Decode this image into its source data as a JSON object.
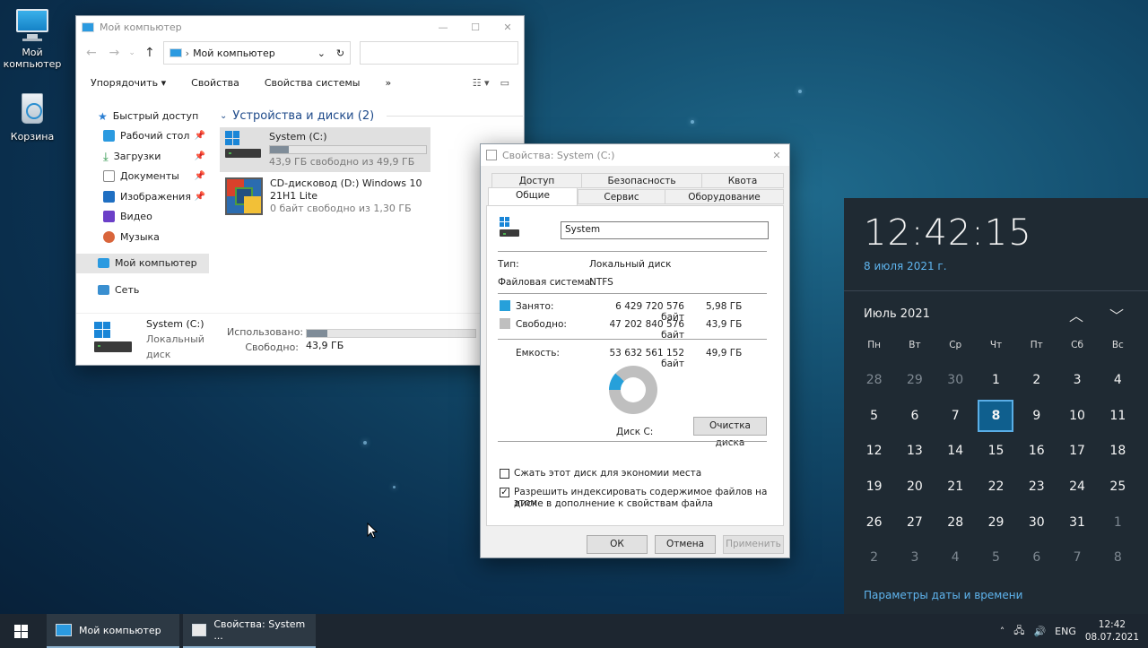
{
  "desktop": {
    "icons": [
      {
        "label": "Мой компьютер"
      },
      {
        "label": "Корзина"
      }
    ]
  },
  "explorer": {
    "title": "Мой компьютер",
    "address": "Мой компьютер",
    "ribbon": [
      "Упорядочить",
      "Свойства",
      "Свойства системы"
    ],
    "ribbon_more": "»",
    "nav": {
      "quick_access": "Быстрый доступ",
      "items": [
        "Рабочий стол",
        "Загрузки",
        "Документы",
        "Изображения",
        "Видео",
        "Музыка"
      ],
      "my_computer": "Мой компьютер",
      "network": "Сеть"
    },
    "group_title": "Устройства и диски (2)",
    "drives": [
      {
        "name": "System  (C:)",
        "free": "43,9 ГБ свободно из 49,9 ГБ",
        "used_fraction": 0.12
      },
      {
        "name": "CD-дисковод (D:) Windows 10",
        "name2": "21H1 Lite",
        "free": "0 байт свободно из 1,30 ГБ"
      }
    ],
    "details": {
      "name": "System  (C:)",
      "type": "Локальный диск",
      "used_label": "Использовано:",
      "free_label": "Свободно:",
      "free_value": "43,9 ГБ",
      "used_fraction": 0.12
    }
  },
  "props": {
    "title": "Свойства: System  (C:)",
    "tabs_row1": [
      "Доступ",
      "Безопасность",
      "Квота"
    ],
    "tabs_row2": [
      "Общие",
      "Сервис",
      "Оборудование"
    ],
    "name_value": "System",
    "type_label": "Тип:",
    "type_value": "Локальный диск",
    "fs_label": "Файловая система:",
    "fs_value": "NTFS",
    "used_label": "Занято:",
    "used_bytes": "6 429 720 576 байт",
    "used_gb": "5,98 ГБ",
    "free_label": "Свободно:",
    "free_bytes": "47 202 840 576 байт",
    "free_gb": "43,9 ГБ",
    "cap_label": "Емкость:",
    "cap_bytes": "53 632 561 152 байт",
    "cap_gb": "49,9 ГБ",
    "disk_label": "Диск C:",
    "cleanup": "Очистка диска",
    "compress": "Сжать этот диск для экономии места",
    "index": "Разрешить индексировать содержимое файлов на этом",
    "index2": "диске в дополнение к свойствам файла",
    "ok": "ОК",
    "cancel": "Отмена",
    "apply": "Применить",
    "used_color": "#26a0da",
    "free_color": "#bfbfbf"
  },
  "calendar": {
    "time": "12:42:15",
    "date": "8 июля 2021 г.",
    "month": "Июль 2021",
    "weekdays": [
      "Пн",
      "Вт",
      "Ср",
      "Чт",
      "Пт",
      "Сб",
      "Вс"
    ],
    "days": [
      {
        "d": "28",
        "dim": true
      },
      {
        "d": "29",
        "dim": true
      },
      {
        "d": "30",
        "dim": true
      },
      {
        "d": "1"
      },
      {
        "d": "2"
      },
      {
        "d": "3"
      },
      {
        "d": "4"
      },
      {
        "d": "5"
      },
      {
        "d": "6"
      },
      {
        "d": "7"
      },
      {
        "d": "8",
        "today": true
      },
      {
        "d": "9"
      },
      {
        "d": "10"
      },
      {
        "d": "11"
      },
      {
        "d": "12"
      },
      {
        "d": "13"
      },
      {
        "d": "14"
      },
      {
        "d": "15"
      },
      {
        "d": "16"
      },
      {
        "d": "17"
      },
      {
        "d": "18"
      },
      {
        "d": "19"
      },
      {
        "d": "20"
      },
      {
        "d": "21"
      },
      {
        "d": "22"
      },
      {
        "d": "23"
      },
      {
        "d": "24"
      },
      {
        "d": "25"
      },
      {
        "d": "26"
      },
      {
        "d": "27"
      },
      {
        "d": "28"
      },
      {
        "d": "29"
      },
      {
        "d": "30"
      },
      {
        "d": "31"
      },
      {
        "d": "1",
        "dim": true
      },
      {
        "d": "2",
        "dim": true
      },
      {
        "d": "3",
        "dim": true
      },
      {
        "d": "4",
        "dim": true
      },
      {
        "d": "5",
        "dim": true
      },
      {
        "d": "6",
        "dim": true
      },
      {
        "d": "7",
        "dim": true
      },
      {
        "d": "8",
        "dim": true
      }
    ],
    "link": "Параметры даты и времени"
  },
  "taskbar": {
    "tasks": [
      "Мой компьютер",
      "Свойства: System ..."
    ],
    "lang": "ENG",
    "time": "12:42",
    "date": "08.07.2021"
  }
}
